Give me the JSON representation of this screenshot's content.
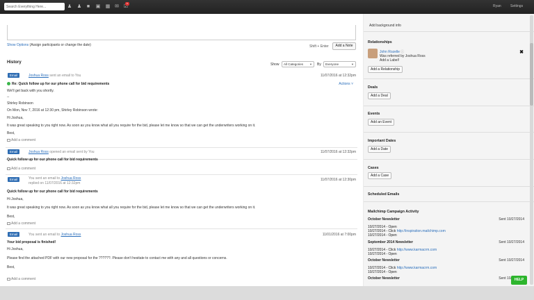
{
  "topbar": {
    "search_placeholder": "Search Everything Here...",
    "badge": "5",
    "user": "Ryan",
    "settings": "Settings",
    "icons": [
      "person-icon",
      "people-icon",
      "building-icon",
      "case-icon",
      "calendar-icon",
      "mail-icon",
      "tasks-icon"
    ]
  },
  "composer": {
    "show_options": "Show Options",
    "show_options_hint": "(Assign participants or change the date)",
    "shift_enter": "Shift + Enter",
    "add_note": "Add a Note"
  },
  "history": {
    "title": "History",
    "show_label": "Show",
    "show_value": "All Categories",
    "by_label": "By",
    "by_value": "Everyone",
    "entries": [
      {
        "tag": "Email",
        "author": "Joshua Ross",
        "meta": "sent an email to You",
        "date": "11/07/2016 at 12:32pm",
        "actions": "Actions",
        "subject": "Re: Quick follow up for our phone call for bid requirements",
        "lines": [
          "We'll get back with you shortly.",
          "--",
          "Shirley Robinson",
          "On Mon, Nov 7, 2016 at 12:30 pm, Shirley Robinson wrote:",
          "Hi Joshua,",
          "It was great speaking to you right now. As soon as you know what all you require for the bid, please let me know so that we can get the underwriters working on it.",
          "Best,"
        ],
        "comment": "Add a comment"
      },
      {
        "tag": "Email",
        "author": "Joshua Ross",
        "meta": "opened an email sent by You",
        "date": "11/07/2016 at 12:32pm",
        "subject": "Quick follow up for our phone call for bid requirements",
        "comment": "Add a comment"
      },
      {
        "tag": "Email",
        "meta_pre": "You sent an email to",
        "author": "Joshua Ross",
        "replied": "replied on 11/07/2016 at 12:32pm",
        "date": "11/07/2016 at 12:30pm",
        "subject": "Quick follow up for our phone call for bid requirements",
        "lines": [
          "Hi Joshua,",
          "It was great speaking to you right now. As soon as you know what all you require for the bid, please let me know so that we can get the underwriters working on it.",
          "Best,"
        ],
        "comment": "Add a comment"
      },
      {
        "tag": "Email",
        "meta_pre": "You sent an email to",
        "author": "Joshua Ross",
        "date": "11/01/2016 at 7:00pm",
        "subject": "Your bid proposal is finished!",
        "lines": [
          "Hi Joshua,",
          "Please find the attached PDF with our new proposal for the ??????. Please don't hesitate to contact me with any and all questions or concerns.",
          "Best,"
        ],
        "comment": "Add a comment"
      }
    ]
  },
  "sidebar": {
    "add_background": "Add background info",
    "relationships_title": "Relationships",
    "rel_name": "John Rozelle",
    "rel_referred": "Was referred by Joshua Ross",
    "rel_label": "Add a Label!",
    "add_relationship": "Add a Relationship",
    "deals_title": "Deals",
    "add_deal": "Add a Deal",
    "events_title": "Events",
    "add_event": "Add an Event",
    "dates_title": "Important Dates",
    "add_date": "Add a Date",
    "cases_title": "Cases",
    "add_case": "Add a Case",
    "scheduled_title": "Scheduled Emails",
    "mailchimp_title": "Mailchimp Campaign Activity",
    "campaigns": [
      {
        "name": "October Newsletter",
        "sent": "Sent 10/27/2014",
        "lines": [
          {
            "text": "10/27/2014 - Open"
          },
          {
            "text": "10/27/2014 - Click",
            "link": "http://inspiration.mailchimp.com"
          },
          {
            "text": "10/27/2014 - Open"
          }
        ]
      },
      {
        "name": "September 2014 Newsletter",
        "sent": "Sent 10/27/2014",
        "lines": [
          {
            "text": "10/27/2014 - Click",
            "link": "http://www.karmacrm.com"
          },
          {
            "text": "10/27/2014 - Open"
          }
        ]
      },
      {
        "name": "October Newsletter",
        "sent": "Sent 10/27/2014",
        "lines": [
          {
            "text": "10/27/2014 - Click",
            "link": "http://www.karmacrm.com"
          },
          {
            "text": "10/27/2014 - Open"
          }
        ]
      },
      {
        "name": "October Newsletter",
        "sent": "Sent 10/27/2014",
        "lines": []
      }
    ]
  },
  "help": "HELP"
}
